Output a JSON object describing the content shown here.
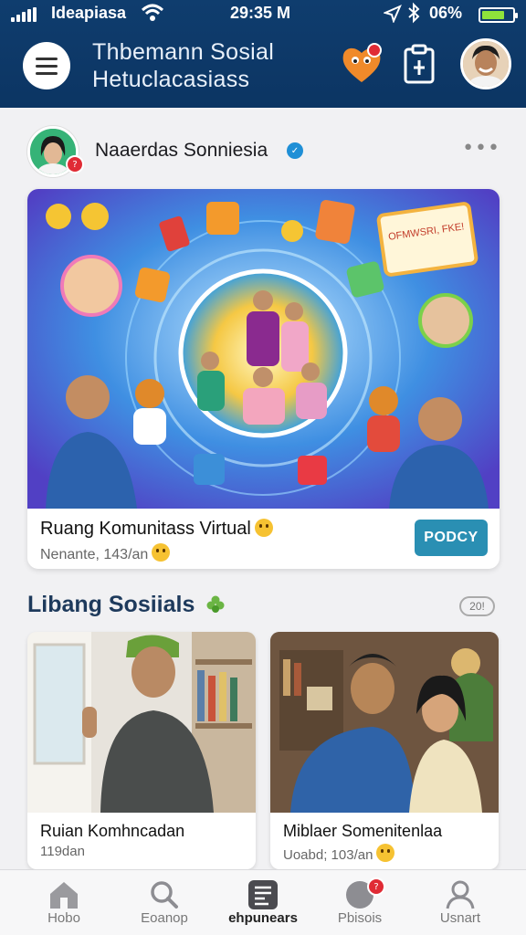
{
  "status_bar": {
    "carrier": "Ideapiasa",
    "time": "29:35 M",
    "battery_pct": "06%",
    "battery_level": 0.75
  },
  "header": {
    "title_line1": "Thbemann Sosial",
    "title_line2": "Hetuclacasiass",
    "icons": [
      "menu-icon",
      "heart-icon",
      "clipboard-icon",
      "avatar"
    ]
  },
  "post": {
    "author": "Naaerdas Sonniesia",
    "author_badge": "?",
    "title": "Ruang Komunitass Virtual",
    "meta": "Nenante, 143/an",
    "button": "PODCY",
    "image_card_text": "OFMWSRI, FKE!"
  },
  "section": {
    "title": "Libang Sosiials",
    "count": "20!"
  },
  "cards": [
    {
      "title": "Ruian Komhncadan",
      "meta": "119dan"
    },
    {
      "title": "Miblaer Somenitenlaa",
      "meta": "Uoabd; 103/an"
    }
  ],
  "bottom_nav": [
    {
      "label": "Hobo",
      "icon": "home-icon"
    },
    {
      "label": "Eoanop",
      "icon": "search-icon"
    },
    {
      "label": "ehpunears",
      "icon": "grid-icon"
    },
    {
      "label": "Pbisois",
      "icon": "notification-icon",
      "badge": "?"
    },
    {
      "label": "Usnart",
      "icon": "user-icon"
    }
  ],
  "colors": {
    "header_bg": "#0f3d6e",
    "accent_button": "#2a8fb3",
    "section_title": "#1e3a5c",
    "badge": "#e02b35"
  }
}
